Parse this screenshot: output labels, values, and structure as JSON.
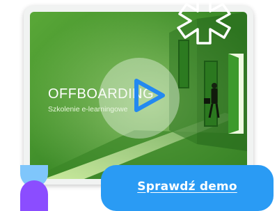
{
  "card": {
    "title": "OFFBOARDING",
    "subtitle": "Szkolenie e-learningowe"
  },
  "cta": {
    "label": "Sprawdź demo"
  },
  "icons": {
    "play": "play-icon",
    "burst": "burst-icon",
    "decor": "decorative-shapes"
  },
  "colors": {
    "screen_green": "#3f8d2a",
    "accent_blue": "#2a9bf4",
    "play_blue": "#2389f0",
    "deco_light_blue": "#7fc6fb",
    "deco_purple": "#8b4dff"
  }
}
